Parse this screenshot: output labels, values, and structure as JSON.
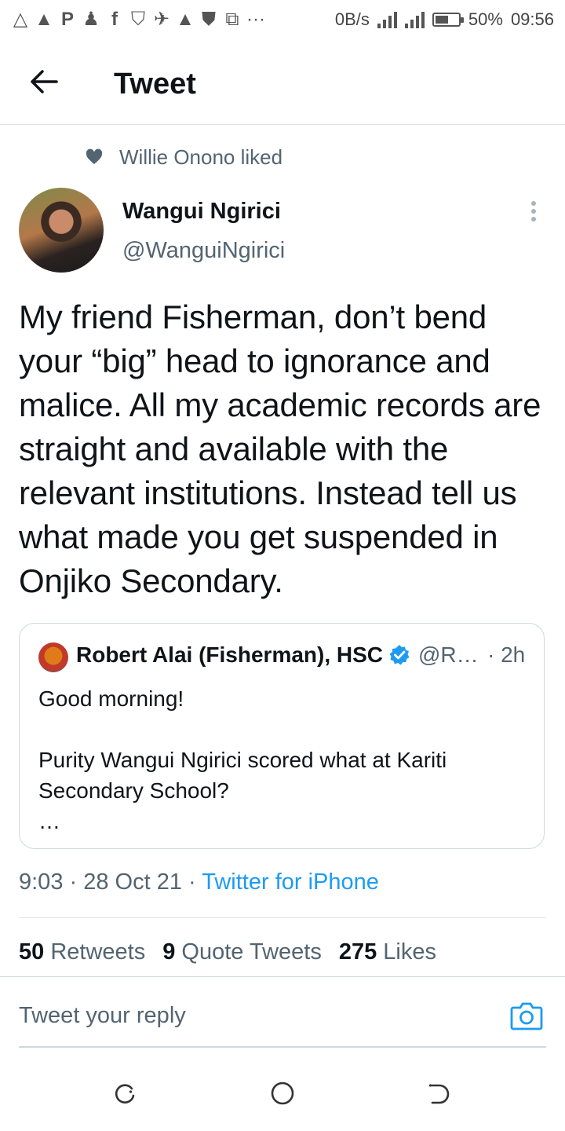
{
  "status_bar": {
    "net_speed": "0B/s",
    "battery": "50%",
    "time": "09:56",
    "left_icons": [
      "warning-icon",
      "warning-filled-icon",
      "parking-icon",
      "add-person-icon",
      "facebook-icon",
      "tshirt-icon",
      "twitter-icon",
      "warning-filled-icon",
      "shield-icon",
      "screen-cast-icon"
    ],
    "more": "···"
  },
  "header": {
    "title": "Tweet"
  },
  "social_context": {
    "text": "Willie Onono liked"
  },
  "author": {
    "name": "Wangui Ngirici",
    "handle": "@WanguiNgirici"
  },
  "tweet": {
    "text": "My friend Fisherman, don’t bend your “big” head to ignorance and malice. All my academic records are straight and available with the relevant institutions. Instead tell us what made you get suspended in Onjiko Secondary."
  },
  "quoted_tweet": {
    "name": "Robert Alai (Fisherman), HSC",
    "handle": "@R…",
    "time": "· 2h",
    "text": "Good morning!\n\nPurity Wangui Ngirici scored what at Kariti Secondary School?\n…"
  },
  "meta": {
    "time": "9:03",
    "sep1": " · ",
    "date": "28 Oct 21",
    "sep2": " · ",
    "source": "Twitter for iPhone"
  },
  "stats": {
    "retweets_count": "50",
    "retweets_label": "Retweets",
    "quotes_count": "9",
    "quotes_label": "Quote Tweets",
    "likes_count": "275",
    "likes_label": "Likes"
  },
  "reply": {
    "placeholder": "Tweet your reply"
  },
  "colors": {
    "accent": "#1d9bf0",
    "secondary_text": "#536471",
    "primary_text": "#0f1419"
  }
}
